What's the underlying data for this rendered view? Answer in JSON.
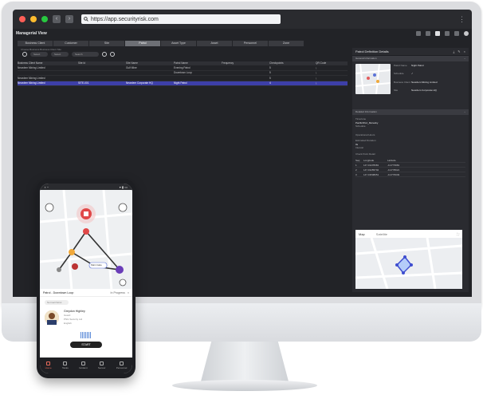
{
  "browser": {
    "url": "https://app.securityrisk.com",
    "traffic_colors": [
      "#ff5f57",
      "#febc2e",
      "#28c840"
    ]
  },
  "app": {
    "title": "Managerial View"
  },
  "tabs": [
    "Business Client",
    "Customer",
    "Site",
    "Patrol",
    "Asset Type",
    "Asset",
    "Personnel",
    "Zone"
  ],
  "active_tab": "Patrol",
  "breadcrumbs": "Choose Business  Business Client        Site",
  "filters": {
    "select1": "Select",
    "select2": "Select",
    "search": "Search"
  },
  "grid": {
    "columns": [
      "Business Client Name",
      "Site Id",
      "Site Name",
      "Patrol Name",
      "Frequency",
      "Checkpoints",
      "QR Code"
    ],
    "rows": [
      [
        "Newclem Mining Limited",
        "",
        "Gulf Mine",
        "Evening Patrol",
        "",
        "5",
        ""
      ],
      [
        "",
        "",
        "",
        "Downtown Loop",
        "",
        "5",
        ""
      ],
      [
        "Newclem Mining Limited",
        "",
        "",
        "",
        "",
        "5",
        ""
      ],
      [
        "Newclem Mining Limited",
        "SITE-001",
        "Newclem Corporate HQ",
        "Night Patrol",
        "",
        "4",
        ""
      ]
    ],
    "selected_row": 3
  },
  "panel": {
    "title": "Patrol Definition Details",
    "general_header": "General Information",
    "general": [
      {
        "k": "Patrol Name",
        "v": "Night Patrol"
      },
      {
        "k": "Schedule",
        "v": ""
      },
      {
        "k": "Business Client",
        "v": "Newclem Mining Limited"
      },
      {
        "k": "Site",
        "v": "Newclem Corporate HQ"
      }
    ],
    "detail_header": "Detailed Information",
    "timezone_label": "Timezone",
    "timezone": "Pacific/Port_Moresby",
    "schedule_label": "Schedule",
    "operational_hours_label": "Operational Hours",
    "duration_label": "Estimated Duration",
    "duration": "0s",
    "interval_label": "Interval",
    "checkpoints_label": "Check Point Detail",
    "cp_columns": [
      "Seq",
      "Longitude",
      "Latitude"
    ],
    "checkpoints": [
      [
        "1",
        "147.19478381",
        "-9.4773981"
      ],
      [
        "2",
        "147.19455702",
        "-9.4778021"
      ],
      [
        "3",
        "147.19508051",
        "-9.4776049"
      ]
    ],
    "map_tabs": [
      "Map",
      "Satellite"
    ]
  },
  "phone": {
    "patrol_title": "Patrol - Downtown Loop",
    "status": "In Progress",
    "tag": "Normal Patrol",
    "person_name": "Greydon Highley",
    "person_role": "Guard",
    "company": "PNG Security Ltd",
    "language": "English",
    "start_label": "START",
    "nav": [
      "Home",
      "Tasks",
      "Incident",
      "Sensor",
      "Personnel"
    ],
    "pin_label": "Main Gate"
  }
}
